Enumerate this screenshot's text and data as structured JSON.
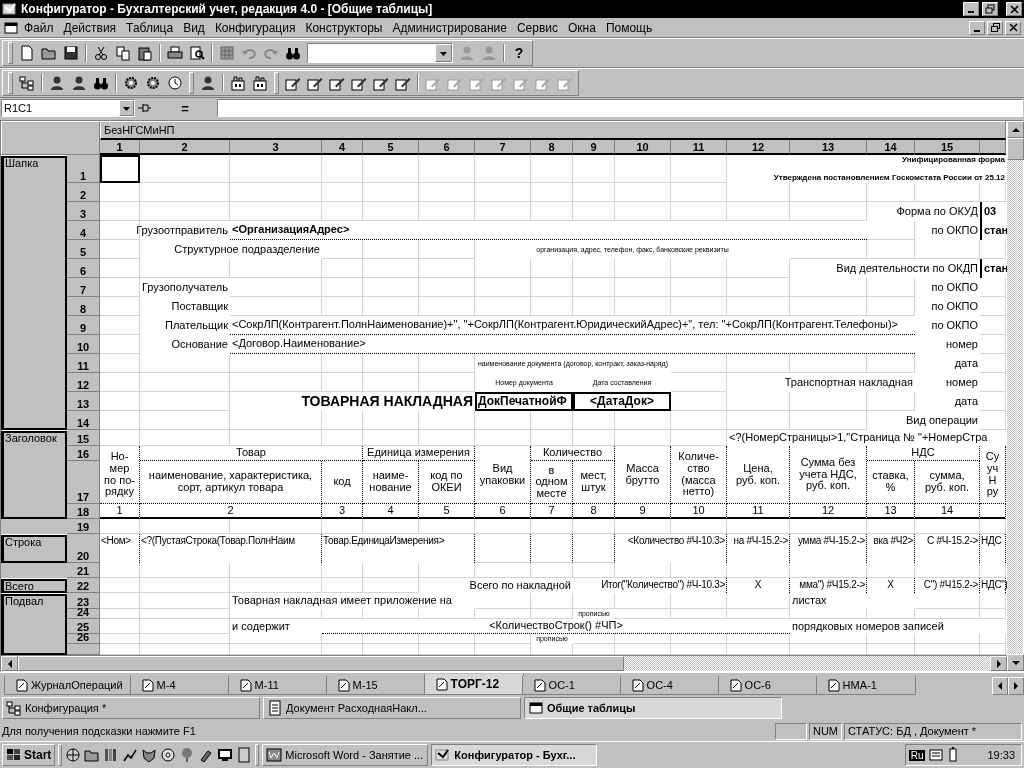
{
  "window": {
    "title": "Конфигуратор - Бухгалтерский учет, редакция 4.0 - [Общие таблицы]"
  },
  "menu": [
    "Файл",
    "Действия",
    "Таблица",
    "Вид",
    "Конфигурация",
    "Конструкторы",
    "Администрирование",
    "Сервис",
    "Окна",
    "Помощь"
  ],
  "toolbar": {
    "help_label": "?"
  },
  "formula_bar": {
    "cell": "R1C1",
    "equals": "="
  },
  "sheet": {
    "band": "БезНГСМиНП",
    "columns": [
      "1",
      "2",
      "3",
      "4",
      "5",
      "6",
      "7",
      "8",
      "9",
      "10",
      "11",
      "12",
      "13",
      "14",
      "15"
    ],
    "groups": [
      {
        "label": "Шапка",
        "rows": [
          {
            "number": "1",
            "cells": [
              {
                "selected": true
              },
              "",
              "",
              "",
              "",
              "",
              "",
              "",
              "",
              "",
              "",
              "Утверждена постановлением Госкомстата России от 25.12",
              "",
              "Унифицированная форма"
            ]
          },
          {
            "number": "2",
            "cells": []
          },
          {
            "number": "3",
            "cells": [
              "",
              "",
              "",
              "",
              "",
              "",
              "",
              "",
              "",
              "",
              "",
              "",
              "",
              "Форма по ОКУД",
              "",
              "03"
            ]
          },
          {
            "number": "4",
            "cells": [
              "",
              "Грузоотправитель",
              "<ОрганизацияАдрес>",
              "",
              "",
              "",
              "",
              "",
              "",
              "",
              "",
              "",
              "",
              "",
              "по ОКПО",
              "стан"
            ]
          },
          {
            "number": "5",
            "cells": [
              "",
              "Структурное подразделение",
              "",
              "",
              "",
              "",
              "организация, адрес, телефон, факс, банковские реквизиты"
            ]
          },
          {
            "number": "6",
            "cells": [
              "",
              "",
              "",
              "",
              "",
              "",
              "",
              "",
              "",
              "",
              "",
              "",
              "Вид деятельности по ОКДП",
              "",
              "",
              "стан"
            ]
          },
          {
            "number": "7",
            "cells": [
              "",
              "Грузополучатель",
              "",
              "",
              "",
              "",
              "",
              "",
              "",
              "",
              "",
              "",
              "",
              "",
              "по ОКПО"
            ]
          },
          {
            "number": "8",
            "cells": [
              "",
              "Поставщик",
              "",
              "",
              "",
              "",
              "",
              "",
              "",
              "",
              "",
              "",
              "",
              "",
              "по ОКПО"
            ]
          },
          {
            "number": "9",
            "cells": [
              "",
              "Плательщик",
              "<СокрЛП(Контрагент.ПолнНаименование)+\", \"+СокрЛП(Контрагент.ЮридическийАдрес)+\", тел: \"+СокрЛП(Контрагент.Телефоны)>",
              "",
              "",
              "",
              "",
              "",
              "",
              "",
              "",
              "",
              "",
              "",
              "по ОКПО"
            ]
          },
          {
            "number": "10",
            "cells": [
              "",
              "Основание",
              "<Договор.Наименование>",
              "",
              "",
              "",
              "",
              "",
              "",
              "",
              "",
              "",
              "",
              "",
              "номер"
            ]
          },
          {
            "number": "11",
            "cells": [
              "",
              "",
              "",
              "",
              "",
              "",
              "наименование документа (договор, контракт, заказ-наряд)",
              "",
              "",
              "",
              "",
              "",
              "",
              "",
              "дата"
            ]
          },
          {
            "number": "12",
            "cells": [
              "",
              "",
              "",
              "",
              "",
              "",
              "Номер документа",
              "",
              "Дата составления",
              "",
              "",
              "Транспортная накладная",
              "",
              "",
              "номер"
            ]
          },
          {
            "number": "13",
            "cells": [
              "",
              "",
              "ТОВАРНАЯ НАКЛАДНАЯ",
              "",
              "",
              "",
              "ДокПечатнойФ",
              "",
              "<ДатаДок>",
              "",
              "",
              "",
              "",
              "",
              "дата"
            ]
          },
          {
            "number": "14",
            "cells": [
              "",
              "",
              "",
              "",
              "",
              "",
              "",
              "",
              "",
              "",
              "",
              "",
              "",
              "Вид операции"
            ]
          }
        ]
      },
      {
        "label": "Заголовок",
        "rows": [
          {
            "number": "15",
            "cells": [
              "",
              "",
              "",
              "",
              "",
              "",
              "",
              "",
              "",
              "",
              "",
              "<?(НомерСтраницы>1,\"Страница № \"+НомерСтра"
            ]
          },
          {
            "number": "16",
            "cells": [
              "Но-\nмер\nпо по-\nрядку",
              "Товар",
              "",
              "",
              "Единица измерения",
              "",
              "Вид\nупаковки",
              "Количество",
              "",
              "Масса\nбрутто",
              "Количе-\nство\n(масса\nнетто)",
              "Цена,\nруб. коп.",
              "Сумма без\nучета НДС,\nруб. коп.",
              "НДС",
              "",
              "Су\nуч\nН\nру"
            ]
          },
          {
            "number": "17",
            "cells": [
              "",
              "наименование, характеристика,\nсорт, артикул товара",
              "",
              "код",
              "наиме-\nнование",
              "код по\nОКЕИ",
              "",
              "в\nодном\nместе",
              "мест,\nштук",
              "",
              "",
              "",
              "",
              "ставка,\n%",
              "сумма,\nруб. коп."
            ]
          },
          {
            "number": "18",
            "cells": [
              "1",
              "2",
              "",
              "3",
              "4",
              "5",
              "6",
              "7",
              "8",
              "9",
              "10",
              "11",
              "12",
              "13",
              "14"
            ]
          }
        ]
      },
      {
        "rows": [
          {
            "number": "19",
            "cells": []
          }
        ]
      },
      {
        "label": "Строка",
        "rows": [
          {
            "number": "20",
            "cells": [
              "<Ном>",
              "<?(ПустаяСтрока(Товар.ПолнНаим",
              "",
              "Товар.ЕдиницаИзмерения>",
              "",
              "",
              "",
              "",
              "",
              "<Количество #Ч-10.3>",
              "",
              "на #Ч-15.2->",
              "умма #Ч-15.2->",
              "вка #Ч2>",
              "С #Ч-15.2->",
              "НДС"
            ]
          }
        ]
      },
      {
        "rows": [
          {
            "number": "21",
            "cells": []
          }
        ]
      },
      {
        "label": "Всего",
        "rows": [
          {
            "number": "22",
            "cells": [
              "",
              "",
              "",
              "",
              "",
              "Всего по накладной",
              "",
              "",
              "Итог(\"Количество\") #Ч-10.3>",
              "",
              "",
              "X",
              "мма\") #Ч15.2->",
              "X",
              "С\") #Ч15.2->",
              "НДС\")"
            ]
          }
        ]
      },
      {
        "label": "Подвал",
        "rows": [
          {
            "number": "23",
            "cells": [
              "",
              "",
              "Товарная накладная имеет приложение на",
              "",
              "",
              "",
              "",
              "",
              "",
              "",
              "",
              "",
              "листах"
            ]
          },
          {
            "number": "24",
            "cells": [
              "",
              "",
              "",
              "",
              "",
              "",
              "",
              "",
              "прописью"
            ]
          },
          {
            "number": "25",
            "cells": [
              "",
              "",
              "и содержит",
              "<КоличествоСтрок() #ЧП>",
              "",
              "",
              "",
              "",
              "",
              "",
              "",
              "",
              "порядковых номеров записей"
            ]
          },
          {
            "number": "26",
            "cells": [
              "",
              "",
              "",
              "",
              "",
              "",
              "",
              "прописью"
            ]
          }
        ]
      }
    ]
  },
  "sheet_tabs": [
    {
      "label": "ЖурналОпераций",
      "selected": false
    },
    {
      "label": "М-4",
      "selected": false
    },
    {
      "label": "М-11",
      "selected": false
    },
    {
      "label": "М-15",
      "selected": false
    },
    {
      "label": "ТОРГ-12",
      "selected": true
    },
    {
      "label": "ОС-1",
      "selected": false
    },
    {
      "label": "ОС-4",
      "selected": false
    },
    {
      "label": "ОС-6",
      "selected": false
    },
    {
      "label": "НМА-1",
      "selected": false
    }
  ],
  "window_tabs": [
    {
      "label": "Конфигурация *",
      "selected": false
    },
    {
      "label": "Документ РасходнаяНакл...",
      "selected": false
    },
    {
      "label": "Общие таблицы",
      "selected": true
    }
  ],
  "status_bar": {
    "hint": "Для получения подсказки нажмите F1",
    "num": "NUM",
    "status": "СТАТУС: БД , Документ *"
  },
  "taskbar": {
    "start": "Start",
    "tasks": [
      {
        "label": "Microsoft Word - Занятие ...",
        "selected": false
      },
      {
        "label": "Конфигуратор - Бухг...",
        "selected": true
      }
    ],
    "language": "Ru",
    "clock": "19:33"
  }
}
